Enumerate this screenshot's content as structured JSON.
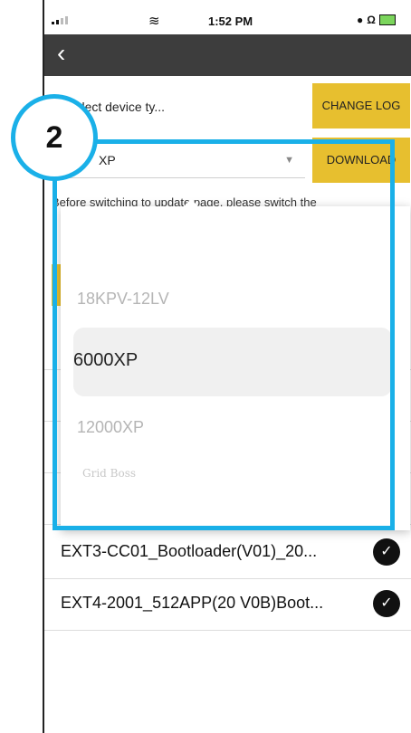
{
  "status_bar": {
    "time": "1:52 PM",
    "carrier_right": "Ω",
    "wifi_icon": "wifi-icon"
  },
  "nav": {
    "back_icon": "chevron-left-icon",
    "back_glyph": "‹"
  },
  "device_type": {
    "placeholder": "Please select device ty...",
    "visible_fragment": "se select device ty...",
    "current_value": "XP"
  },
  "buttons": {
    "change_log": "CHANGE LOG",
    "download": "DOWNLOAD"
  },
  "notice": {
    "text": "Before switching to update page, please switch the"
  },
  "picker": {
    "options": [
      "18KPV-12LV",
      "6000XP",
      "12000XP",
      "Grid Boss"
    ],
    "selected": "6000XP"
  },
  "list": {
    "items": [
      {
        "label": "EXT3-CC01_Bootloader(V01)_20...",
        "checked": true
      },
      {
        "label": "EXT4-2001_512APP(20 V0B)Boot...",
        "checked": true
      }
    ]
  },
  "annotation": {
    "step_number": "2",
    "color": "#1ab0e8"
  },
  "colors": {
    "accent": "#e7bf2f",
    "navbar": "#3d3d3d"
  }
}
